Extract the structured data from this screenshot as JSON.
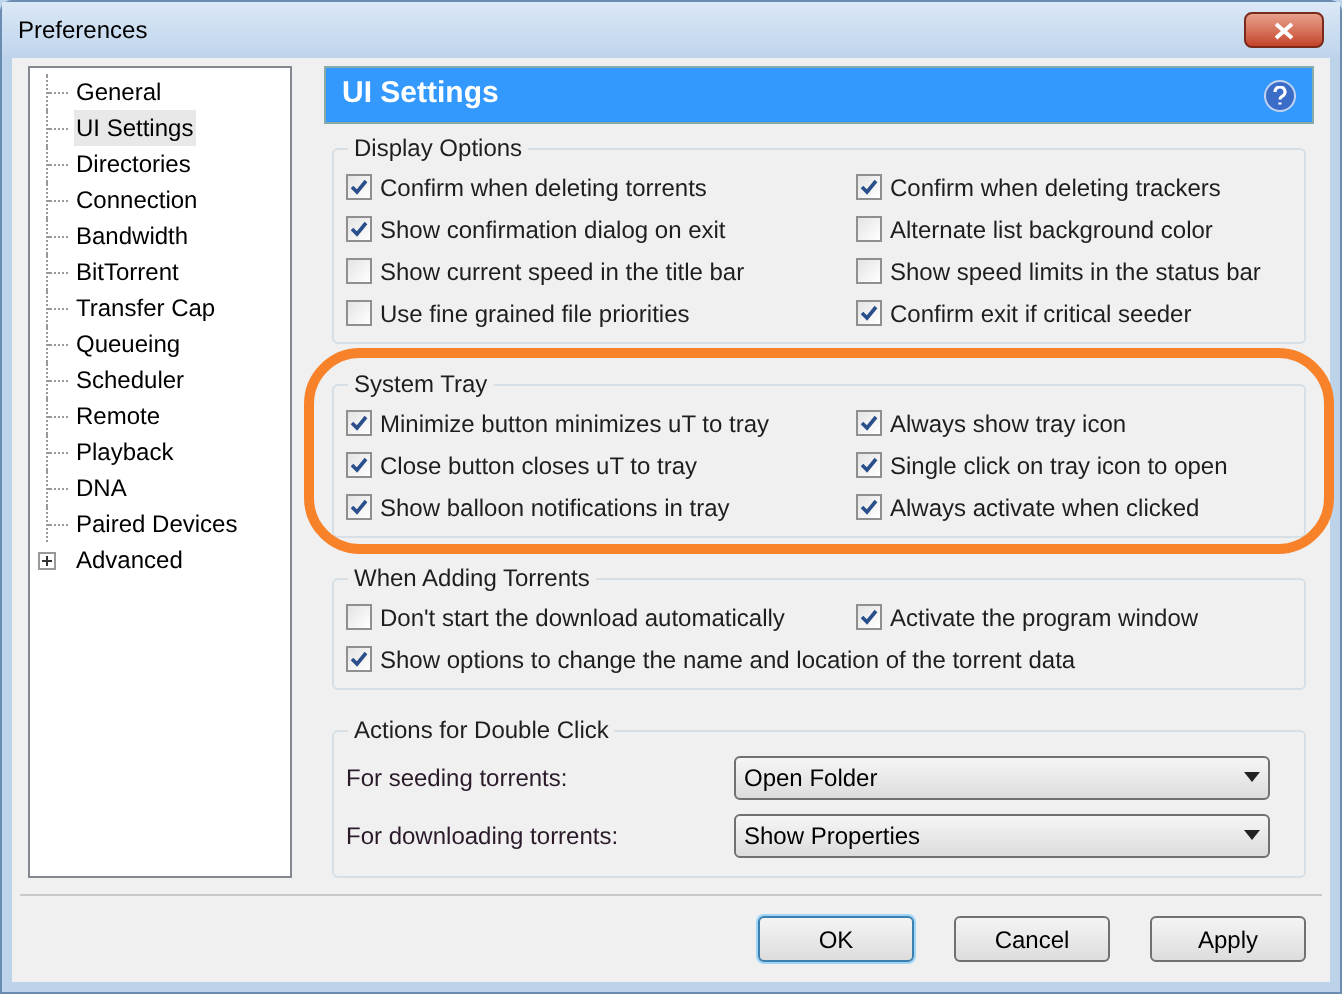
{
  "window": {
    "title": "Preferences"
  },
  "sidebar": {
    "items": [
      {
        "label": "General",
        "selected": false
      },
      {
        "label": "UI Settings",
        "selected": true
      },
      {
        "label": "Directories",
        "selected": false
      },
      {
        "label": "Connection",
        "selected": false
      },
      {
        "label": "Bandwidth",
        "selected": false
      },
      {
        "label": "BitTorrent",
        "selected": false
      },
      {
        "label": "Transfer Cap",
        "selected": false
      },
      {
        "label": "Queueing",
        "selected": false
      },
      {
        "label": "Scheduler",
        "selected": false
      },
      {
        "label": "Remote",
        "selected": false
      },
      {
        "label": "Playback",
        "selected": false
      },
      {
        "label": "DNA",
        "selected": false
      },
      {
        "label": "Paired Devices",
        "selected": false
      },
      {
        "label": "Advanced",
        "selected": false,
        "expanded": false
      }
    ]
  },
  "header": {
    "title": "UI Settings"
  },
  "groups": [
    {
      "title": "Display Options",
      "options": [
        {
          "label": "Confirm when deleting torrents",
          "checked": true
        },
        {
          "label": "Confirm when deleting trackers",
          "checked": true
        },
        {
          "label": "Show confirmation dialog on exit",
          "checked": true
        },
        {
          "label": "Alternate list background color",
          "checked": false
        },
        {
          "label": "Show current speed in the title bar",
          "checked": false
        },
        {
          "label": "Show speed limits in the status bar",
          "checked": false
        },
        {
          "label": "Use fine grained file priorities",
          "checked": false
        },
        {
          "label": "Confirm exit if critical seeder",
          "checked": true
        }
      ]
    },
    {
      "title": "System Tray",
      "highlighted": true,
      "options": [
        {
          "label": "Minimize button minimizes uT to tray",
          "checked": true
        },
        {
          "label": "Always show tray icon",
          "checked": true
        },
        {
          "label": "Close button closes uT to tray",
          "checked": true
        },
        {
          "label": "Single click on tray icon to open",
          "checked": true
        },
        {
          "label": "Show balloon notifications in tray",
          "checked": true
        },
        {
          "label": "Always activate when clicked",
          "checked": true
        }
      ]
    },
    {
      "title": "When Adding Torrents",
      "options": [
        {
          "label": "Don't start the download automatically",
          "checked": false
        },
        {
          "label": "Activate the program window",
          "checked": true
        },
        {
          "label": "Show options to change the name and location of the torrent data",
          "checked": true
        }
      ]
    }
  ],
  "double_click": {
    "title": "Actions for Double Click",
    "rows": [
      {
        "label": "For seeding torrents:",
        "value": "Open Folder"
      },
      {
        "label": "For downloading torrents:",
        "value": "Show Properties"
      }
    ]
  },
  "buttons": [
    "OK",
    "Cancel",
    "Apply"
  ]
}
